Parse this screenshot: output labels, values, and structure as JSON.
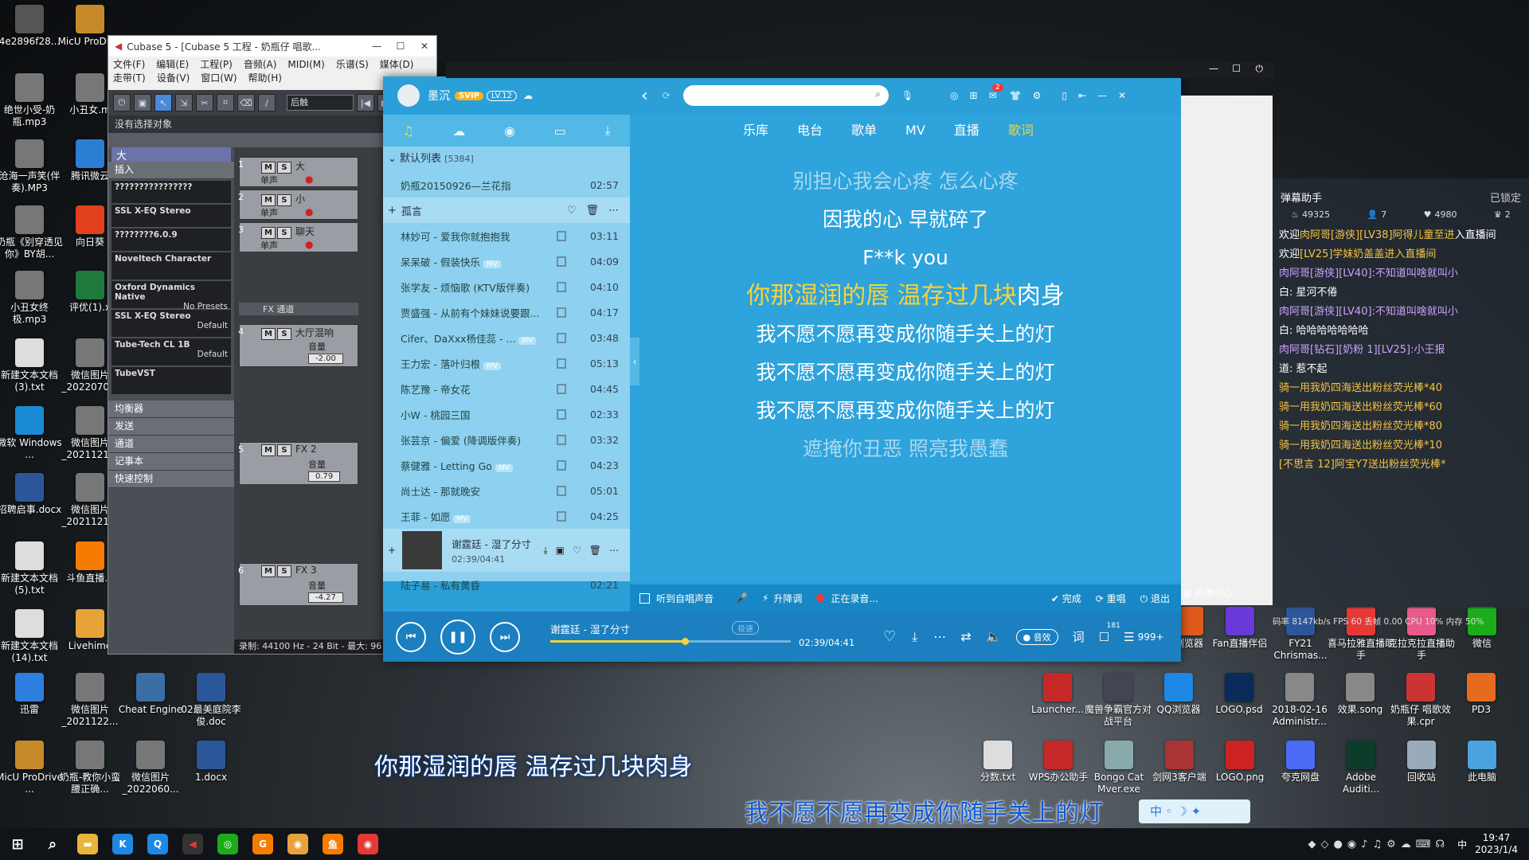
{
  "desktop_left": [
    {
      "label": "4e2896f28...",
      "icon": "qr-icon",
      "color": "#555"
    },
    {
      "label": "MicU ProDri...",
      "icon": "folder-icon",
      "color": "#c78a2a"
    },
    {
      "label": "绝世小受-奶瓶.mp3",
      "icon": "music-file-icon",
      "color": "#777"
    },
    {
      "label": "小丑女.m",
      "icon": "music-file-icon",
      "color": "#777"
    },
    {
      "label": "沧海一声笑(伴奏).MP3",
      "icon": "music-file-icon",
      "color": "#777"
    },
    {
      "label": "腾讯微云",
      "icon": "cloud-icon",
      "color": "#2a7fd4"
    },
    {
      "label": "奶瓶《别穿透见你》BY胡...",
      "icon": "image-file-icon",
      "color": "#777"
    },
    {
      "label": "向日葵",
      "icon": "sunflower-icon",
      "color": "#e2401c"
    },
    {
      "label": "小丑女终极.mp3",
      "icon": "music-file-icon",
      "color": "#777"
    },
    {
      "label": "评优(1).x",
      "icon": "excel-icon",
      "color": "#1d7a3c"
    },
    {
      "label": "新建文本文档(3).txt",
      "icon": "text-file-icon",
      "color": "#ddd"
    },
    {
      "label": "微信图片_2022070...",
      "icon": "image-file-icon",
      "color": "#777"
    },
    {
      "label": "微软 Windows ...",
      "icon": "windows-icon",
      "color": "#1a8ad4"
    },
    {
      "label": "微信图片_2021121...",
      "icon": "image-file-icon",
      "color": "#777"
    },
    {
      "label": "招聘启事.docx",
      "icon": "word-icon",
      "color": "#2b579a"
    },
    {
      "label": "微信图片_2021121...",
      "icon": "image-file-icon",
      "color": "#777"
    },
    {
      "label": "新建文本文档(5).txt",
      "icon": "text-file-icon",
      "color": "#ddd"
    },
    {
      "label": "斗鱼直播...",
      "icon": "douyu-icon",
      "color": "#f57c00"
    },
    {
      "label": "新建文本文档(14).txt",
      "icon": "text-file-icon",
      "color": "#ddd"
    },
    {
      "label": "Livehime",
      "icon": "livehime-icon",
      "color": "#e8a23a"
    }
  ],
  "desktop_bottom": [
    {
      "label": "迅雷",
      "icon": "xunlei-icon",
      "color": "#2e7fe0"
    },
    {
      "label": "微信图片_2021122...",
      "icon": "image-file-icon",
      "color": "#777"
    },
    {
      "label": "Cheat Engine",
      "icon": "cheat-engine-icon",
      "color": "#3a6ea5"
    },
    {
      "label": "02最美庭院李俊.doc",
      "icon": "word-icon",
      "color": "#2b579a"
    },
    {
      "label": "MicU ProDrive ...",
      "icon": "folder-icon",
      "color": "#c78a2a"
    },
    {
      "label": "奶瓶-教你小蛮腰正确...",
      "icon": "image-file-icon",
      "color": "#777"
    },
    {
      "label": "微信图片_2022060...",
      "icon": "image-file-icon",
      "color": "#777"
    },
    {
      "label": "1.docx",
      "icon": "word-icon",
      "color": "#2b579a"
    }
  ],
  "desktop_right": [
    {
      "label": "浏览器",
      "icon": "browser-icon",
      "color": "#e05a1c"
    },
    {
      "label": "Fan直播伴侣",
      "icon": "fan-icon",
      "color": "#6a3ad8"
    },
    {
      "label": "FY21 Chrismas...",
      "icon": "word-icon",
      "color": "#2b579a"
    },
    {
      "label": "喜马拉雅直播助手",
      "icon": "ximalaya-icon",
      "color": "#e53935"
    },
    {
      "label": "克拉克拉直播助手",
      "icon": "kela-icon",
      "color": "#e85a8a"
    },
    {
      "label": "微信",
      "icon": "wechat-icon",
      "color": "#1aad19"
    },
    {
      "label": "Launcher...",
      "icon": "launcher-icon",
      "color": "#c62828"
    },
    {
      "label": "魔兽争霸官方对战平台",
      "icon": "warcraft-icon",
      "color": "#445"
    },
    {
      "label": "QQ浏览器",
      "icon": "qq-browser-icon",
      "color": "#1e88e5"
    },
    {
      "label": "LOGO.psd",
      "icon": "photoshop-icon",
      "color": "#0a2a5a"
    },
    {
      "label": "2018-02-16 Administr...",
      "icon": "file-icon",
      "color": "#888"
    },
    {
      "label": "效果.song",
      "icon": "file-icon",
      "color": "#888"
    },
    {
      "label": "奶瓶仔 唱歌效果.cpr",
      "icon": "cubase-file-icon",
      "color": "#c33"
    },
    {
      "label": "PD3",
      "icon": "pd3-icon",
      "color": "#e76b1f"
    },
    {
      "label": "分数.txt",
      "icon": "text-file-icon",
      "color": "#ddd"
    },
    {
      "label": "WPS办公助手",
      "icon": "wps-icon",
      "color": "#c62828"
    },
    {
      "label": "Bongo Cat Mver.exe",
      "icon": "bongo-cat-icon",
      "color": "#8aa"
    },
    {
      "label": "剑网3客户端",
      "icon": "jx3-icon",
      "color": "#a33"
    },
    {
      "label": "LOGO.png",
      "icon": "image-file-icon",
      "color": "#c22"
    },
    {
      "label": "夸克网盘",
      "icon": "quark-icon",
      "color": "#4a6cf7"
    },
    {
      "label": "Adobe Auditi...",
      "icon": "audition-icon",
      "color": "#0b3d2a"
    },
    {
      "label": "回收站",
      "icon": "recycle-bin-icon",
      "color": "#9ab"
    },
    {
      "label": "此电脑",
      "icon": "computer-icon",
      "color": "#4aa3e0"
    }
  ],
  "cubase": {
    "title": "Cubase 5 - [Cubase 5 工程 - 奶瓶仔 唱歌...",
    "menu_row1": [
      "文件(F)",
      "编辑(E)",
      "工程(P)",
      "音频(A)",
      "MIDI(M)",
      "乐谱(S)",
      "媒体(D)"
    ],
    "menu_row2": [
      "走带(T)",
      "设备(V)",
      "窗口(W)",
      "帮助(H)"
    ],
    "mode_select": "后触",
    "no_selection": "没有选择对象",
    "track_name": "大",
    "insert_label": "插入",
    "slots": [
      "????????????????",
      "SSL X-EQ Stereo",
      "????????6.0.9",
      "Noveltech Character",
      "Oxford Dynamics Native",
      "SSL X-EQ Stereo",
      "Tube-Tech CL 1B",
      "TubeVST"
    ],
    "slot_presets": [
      "",
      "",
      "",
      "",
      "No Presets",
      "Default",
      "Default",
      ""
    ],
    "sections": [
      "均衡器",
      "发送",
      "通道",
      "记事本",
      "快速控制"
    ],
    "tracks": [
      {
        "num": "1",
        "name": "大",
        "sub": "单声"
      },
      {
        "num": "2",
        "name": "小",
        "sub": "单声"
      },
      {
        "num": "3",
        "name": "聊天",
        "sub": "单声"
      }
    ],
    "fx_folder": "FX 通道",
    "fx_tracks": [
      {
        "num": "4",
        "name": "大厅混响",
        "vol_label": "音量",
        "vol": "-2.00"
      },
      {
        "num": "5",
        "name": "FX 2",
        "vol_label": "音量",
        "vol": "0.79"
      },
      {
        "num": "6",
        "name": "FX 3",
        "vol_label": "音量",
        "vol": "-4.27"
      }
    ],
    "status": "录制: 44100 Hz - 24 Bit - 最大: 96"
  },
  "kugou": {
    "user": "墨沉",
    "svip": "SVIP",
    "level": "LV.12",
    "badge_count": "2",
    "nav": [
      "乐库",
      "电台",
      "歌单",
      "MV",
      "直播",
      "歌词"
    ],
    "active_nav": "歌词",
    "list_title": "默认列表",
    "list_count": "[5384]",
    "top_song": {
      "title": "奶瓶20150926—兰花指",
      "dur": "02:57"
    },
    "group": "孤言",
    "songs": [
      {
        "title": "林妙可 - 爱我你就抱抱我",
        "dur": "03:11",
        "mv": false
      },
      {
        "title": "呆呆破 - 假装快乐",
        "dur": "04:09",
        "mv": true
      },
      {
        "title": "张学友 - 烦恼歌 (KTV版伴奏)",
        "dur": "04:10",
        "mv": false
      },
      {
        "title": "贾盛强 - 从前有个妹妹说要跟...",
        "dur": "04:17",
        "mv": false
      },
      {
        "title": "Cifer、DaXxx杨佳蕊 - ...",
        "dur": "03:48",
        "mv": true
      },
      {
        "title": "王力宏 - 落叶归根",
        "dur": "05:13",
        "mv": true
      },
      {
        "title": "陈艺豫 - 帝女花",
        "dur": "04:45",
        "mv": false
      },
      {
        "title": "小W - 桃园三国",
        "dur": "02:33",
        "mv": false
      },
      {
        "title": "张芸京 - 偏爱 (降调版伴奏)",
        "dur": "03:32",
        "mv": false
      },
      {
        "title": "蔡健雅 - Letting Go",
        "dur": "04:23",
        "mv": true
      },
      {
        "title": "尚士达 - 那就晚安",
        "dur": "05:01",
        "mv": false
      },
      {
        "title": "王菲 - 如愿",
        "dur": "04:25",
        "mv": true
      }
    ],
    "now_playing": {
      "title": "谢霆廷 - 湿了分寸",
      "time": "02:39/04:41"
    },
    "after_song": {
      "title": "陆子易 - 私有黄昏",
      "dur": "02:21"
    },
    "lyrics": [
      {
        "text": "别担心我会心疼 怎么心疼",
        "state": "faded"
      },
      {
        "text": "因我的心 早就碎了",
        "state": "normal"
      },
      {
        "text": "F**k you",
        "state": "normal"
      },
      {
        "text": "你那湿润的唇 温存过几块肉身",
        "state": "current",
        "sung": "你那湿润的唇 温存过几块",
        "rest": "肉身"
      },
      {
        "text": "我不愿不愿再变成你随手关上的灯",
        "state": "normal"
      },
      {
        "text": "我不愿不愿再变成你随手关上的灯",
        "state": "normal"
      },
      {
        "text": "我不愿不愿再变成你随手关上的灯",
        "state": "normal"
      },
      {
        "text": "遮掩你丑恶 照亮我愚蠢",
        "state": "faded"
      }
    ],
    "ktv": {
      "hear": "听到自唱声音",
      "raise": "升降调",
      "recording": "正在录音...",
      "done": "完成",
      "resing": "重唱",
      "exit": "退出"
    },
    "player": {
      "title": "谢霆廷 - 湿了分寸",
      "time": "02:39/04:41",
      "progress": 0.56,
      "quality": "极速",
      "effect": "音效",
      "lyric": "词",
      "comments": "181",
      "list_count": "999+"
    },
    "colors": {
      "accent": "#f6d23a",
      "bg": "#2a9fd8"
    }
  },
  "chat": {
    "title": "弹幕助手",
    "locked": "已锁定",
    "stats": [
      "49325",
      "7",
      "4980",
      "2"
    ],
    "messages": [
      {
        "parts": [
          {
            "t": "欢迎",
            "c": "w"
          },
          {
            "t": "肉阿哥[游侠][LV38]阿得儿童至进",
            "c": "y"
          },
          {
            "t": "入直播间",
            "c": "w"
          }
        ]
      },
      {
        "parts": [
          {
            "t": "欢迎",
            "c": "w"
          },
          {
            "t": "[LV25]学妹奶盖盖进入直播间",
            "c": "y"
          }
        ]
      },
      {
        "parts": [
          {
            "t": "肉阿哥[游侠][LV40]:不知道叫啥就叫小",
            "c": "p"
          }
        ]
      },
      {
        "parts": [
          {
            "t": "白: 星河不倦",
            "c": "w"
          }
        ]
      },
      {
        "parts": [
          {
            "t": "肉阿哥[游侠][LV40]:不知道叫啥就叫小",
            "c": "p"
          }
        ]
      },
      {
        "parts": [
          {
            "t": "白: 哈哈哈哈哈哈哈",
            "c": "w"
          }
        ]
      },
      {
        "parts": [
          {
            "t": "肉阿哥[钻石][奶粉 1][LV25]:小王报",
            "c": "p"
          }
        ]
      },
      {
        "parts": [
          {
            "t": "道: 惹不起",
            "c": "w"
          }
        ]
      },
      {
        "parts": [
          {
            "t": "骑一用我奶四海送出粉丝荧光棒*40",
            "c": "y"
          }
        ]
      },
      {
        "parts": [
          {
            "t": "骑一用我奶四海送出粉丝荧光棒*60",
            "c": "y"
          }
        ]
      },
      {
        "parts": [
          {
            "t": "骑一用我奶四海送出粉丝荧光棒*80",
            "c": "y"
          }
        ]
      },
      {
        "parts": [
          {
            "t": "骑一用我奶四海送出粉丝荧光棒*10",
            "c": "y"
          }
        ]
      },
      {
        "parts": [
          {
            "t": "[不思言 12]阿宝Y7送出粉丝荧光棒*",
            "c": "y"
          }
        ]
      }
    ],
    "footer": "码率 8147kb/s FPS 60 丢帧 0.00 CPU 10% 内存 50%",
    "app_center": "应用中心"
  },
  "subtitles": {
    "line1": "你那湿润的唇 温存过几块肉身",
    "line2": "我不愿不愿再变成你随手关上的灯"
  },
  "ime": {
    "label": "中"
  },
  "taskbar": {
    "time": "19:47",
    "date": "2023/1/4",
    "ime": "中"
  }
}
